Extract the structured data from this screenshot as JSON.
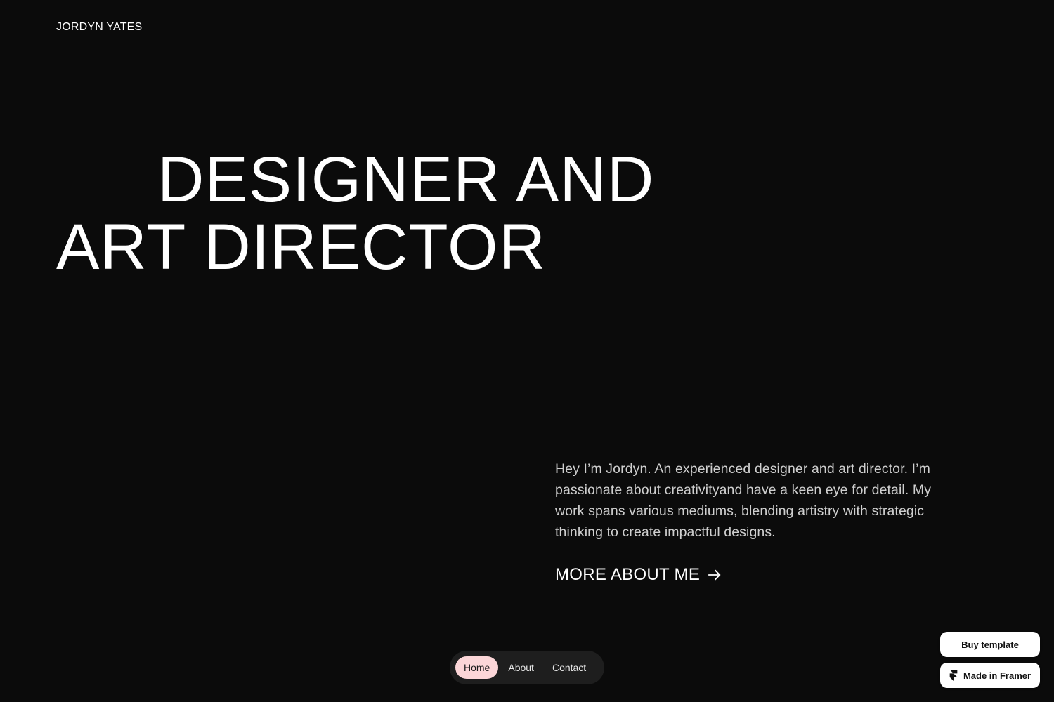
{
  "header": {
    "brand": "JORDYN YATES"
  },
  "hero": {
    "line1": "DESIGNER AND",
    "line2": "ART DIRECTOR"
  },
  "intro": {
    "bio": "Hey I’m Jordyn. An experienced designer and art director. I’m passionate about creativityand have a keen eye for detail. My work spans various mediums, blending artistry with strategic thinking to create impactful designs.",
    "more_link": "MORE ABOUT ME",
    "more_icon": "arrow-right-icon"
  },
  "nav": {
    "items": [
      {
        "label": "Home",
        "active": true
      },
      {
        "label": "About",
        "active": false
      },
      {
        "label": "Contact",
        "active": false
      }
    ],
    "active_color": "#fcd6d8",
    "pill_color": "#1e1e1e"
  },
  "badges": {
    "buy": "Buy template",
    "framer": "Made in Framer",
    "framer_icon": "framer-logo-icon"
  },
  "colors": {
    "background": "#0b0b0b",
    "text": "#ffffff",
    "muted_text": "#cfcfcf"
  }
}
